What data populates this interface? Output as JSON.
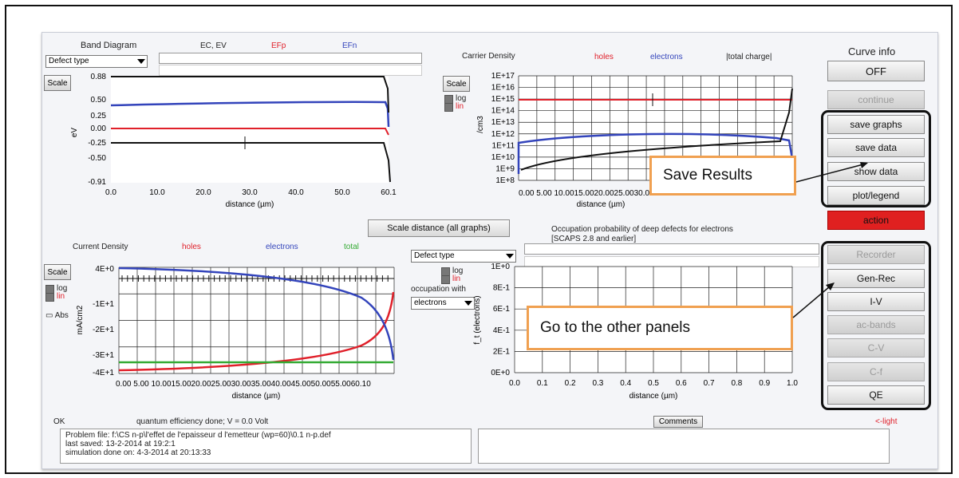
{
  "band_diagram": {
    "title": "Band Diagram",
    "legend": [
      "EC, EV",
      "EFp",
      "EFn"
    ],
    "select_value": "Defect type",
    "scale_label": "Scale",
    "ylabel": "eV",
    "xlabel": "distance (µm)",
    "yticks": [
      "0.88",
      "0.50",
      "0.25",
      "0.00",
      "-0.25",
      "-0.50",
      "-0.91"
    ],
    "xticks": [
      "0.0",
      "10.0",
      "20.0",
      "30.0",
      "40.0",
      "50.0",
      "60.1"
    ]
  },
  "carrier_density": {
    "title": "Carrier Density",
    "legend": [
      "holes",
      "electrons",
      "|total charge|"
    ],
    "scale_label": "Scale",
    "log_label": "log",
    "lin_label": "lin",
    "ylabel": "/cm3",
    "xlabel": "distance (µm)",
    "yticks": [
      "1E+17",
      "1E+16",
      "1E+15",
      "1E+14",
      "1E+13",
      "1E+12",
      "1E+11",
      "1E+10",
      "1E+9",
      "1E+8"
    ],
    "xticks": "0.00  5.00 10.0015.0020.0025.0030.00"
  },
  "scale_distance_label": "Scale distance (all graphs)",
  "current_density": {
    "title": "Current Density",
    "legend": [
      "holes",
      "electrons",
      "total"
    ],
    "scale_label": "Scale",
    "log_label": "log",
    "lin_label": "lin",
    "abs_label": "Abs",
    "ylabel": "mA/cm2",
    "xlabel": "distance (µm)",
    "yticks": [
      "4E+0",
      "-1E+1",
      "-2E+1",
      "-3E+1",
      "-4E+1"
    ],
    "xticks": "0.00  5.00 10.0015.0020.0025.0030.0035.0040.0045.0050.0055.0060.10"
  },
  "occupation": {
    "title": "Occupation probability of deep defects for electrons",
    "subtitle": "[SCAPS 2.8 and earlier]",
    "select_value": "Defect type",
    "log_label": "log",
    "lin_label": "lin",
    "occupation_with_label": "occupation with",
    "carrier_select": "electrons",
    "ylabel": "f_t (electrons)",
    "xlabel": "distance (µm)",
    "yticks": [
      "1E+0",
      "8E-1",
      "6E-1",
      "4E-1",
      "2E-1",
      "0E+0"
    ],
    "xticks": [
      "0.0",
      "0.1",
      "0.2",
      "0.3",
      "0.4",
      "0.5",
      "0.6",
      "0.7",
      "0.8",
      "0.9",
      "1.0"
    ]
  },
  "right_panel": {
    "curve_info_label": "Curve info",
    "off_button": "OFF",
    "continue_button": "continue",
    "save_graphs": "save graphs",
    "save_data": "save data",
    "show_data": "show data",
    "plot_legend": "plot/legend",
    "action": "action",
    "recorder": "Recorder",
    "gen_rec": "Gen-Rec",
    "iv": "I-V",
    "ac_bands": "ac-bands",
    "cv": "C-V",
    "cf": "C-f",
    "qe": "QE"
  },
  "callouts": {
    "save_results": "Save Results",
    "go_panels": "Go to the other  panels"
  },
  "status": {
    "ok": "OK",
    "message": "quantum efficiency done; V = 0.0 Volt",
    "comments_button": "Comments",
    "light": "<-light",
    "log_lines": [
      "Problem file: f:\\CS n-p\\l'effet de l'epaisseur  d l'emetteur (wp=60)\\0.1 n-p.def",
      "last saved: 13-2-2014 at 19:2:1",
      "simulation done on: 4-3-2014 at 20:13:33"
    ]
  },
  "colors": {
    "holes": "#e0202a",
    "electrons": "#3344bb",
    "total": "#33aa33",
    "black": "#111111",
    "action": "#e02020",
    "callout_border": "#f0a050"
  }
}
